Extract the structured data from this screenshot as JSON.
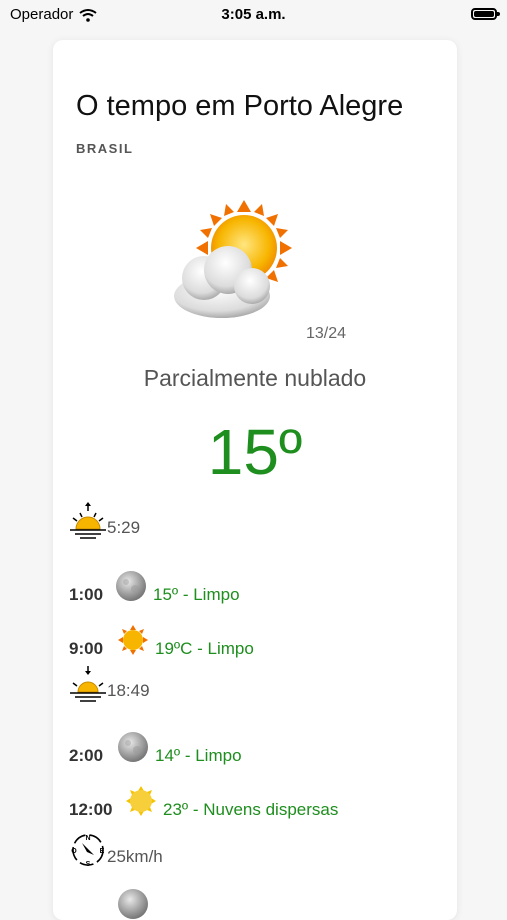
{
  "status_bar": {
    "carrier": "Operador",
    "time": "3:05 a.m."
  },
  "header": {
    "title": "O tempo em Porto Alegre",
    "country": "BRASIL"
  },
  "current": {
    "icon": "partly-cloudy-icon",
    "update": "13/24",
    "condition": "Parcialmente nublado",
    "temperature": "15º"
  },
  "forecast": [
    {
      "type": "sunrise",
      "icon": "sunrise-icon",
      "text": "5:29"
    },
    {
      "type": "hour",
      "hour": "1:00",
      "icon": "moon-icon",
      "text": "15º - Limpo"
    },
    {
      "type": "hour",
      "hour": "9:00",
      "icon": "sun-icon",
      "text": "19ºC - Limpo"
    },
    {
      "type": "sunset",
      "icon": "sunset-icon",
      "text": "18:49"
    },
    {
      "type": "hour",
      "hour": "2:00",
      "icon": "moon-icon",
      "text": "14º - Limpo"
    },
    {
      "type": "hour",
      "hour": "12:00",
      "icon": "sun-icon",
      "text": "23º - Nuvens dispersas"
    },
    {
      "type": "wind",
      "icon": "compass-icon",
      "text": "25km/h"
    }
  ],
  "colors": {
    "accent_green": "#1e8e1e",
    "sun": "#f7b500"
  }
}
